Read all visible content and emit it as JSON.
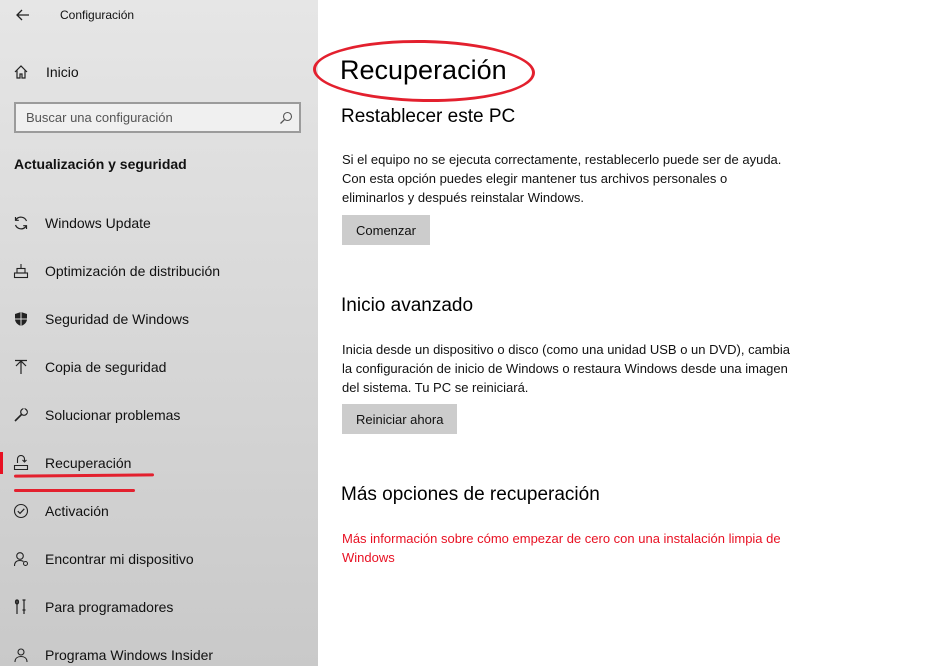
{
  "app": {
    "title": "Configuración"
  },
  "sidebar": {
    "home_label": "Inicio",
    "search": {
      "placeholder": "Buscar una configuración",
      "value": ""
    },
    "section_title": "Actualización y seguridad",
    "items": [
      {
        "label": "Windows Update",
        "icon": "sync-icon",
        "selected": false
      },
      {
        "label": "Optimización de distribución",
        "icon": "delivery-optimization-icon",
        "selected": false
      },
      {
        "label": "Seguridad de Windows",
        "icon": "shield-icon",
        "selected": false
      },
      {
        "label": "Copia de seguridad",
        "icon": "upload-arrow-icon",
        "selected": false
      },
      {
        "label": "Solucionar problemas",
        "icon": "wrench-icon",
        "selected": false
      },
      {
        "label": "Recuperación",
        "icon": "recovery-icon",
        "selected": true
      },
      {
        "label": "Activación",
        "icon": "check-circle-icon",
        "selected": false
      },
      {
        "label": "Encontrar mi dispositivo",
        "icon": "person-pin-icon",
        "selected": false
      },
      {
        "label": "Para programadores",
        "icon": "developer-tools-icon",
        "selected": false
      },
      {
        "label": "Programa Windows Insider",
        "icon": "insider-icon",
        "selected": false
      }
    ]
  },
  "main": {
    "title": "Recuperación",
    "reset": {
      "heading": "Restablecer este PC",
      "text": "Si el equipo no se ejecuta correctamente, restablecerlo puede ser de ayuda. Con esta opción puedes elegir mantener tus archivos personales o eliminarlos y después reinstalar Windows.",
      "button": "Comenzar"
    },
    "advanced": {
      "heading": "Inicio avanzado",
      "text": "Inicia desde un dispositivo o disco (como una unidad USB o un DVD), cambia la configuración de inicio de Windows o restaura Windows desde una imagen del sistema. Tu PC se reiniciará.",
      "button": "Reiniciar ahora"
    },
    "more": {
      "heading": "Más opciones de recuperación",
      "link": "Más información sobre cómo empezar de cero con una instalación limpia de Windows"
    }
  },
  "colors": {
    "accent": "#e81123",
    "annotation": "#e3202e",
    "button_bg": "#cccccc"
  }
}
